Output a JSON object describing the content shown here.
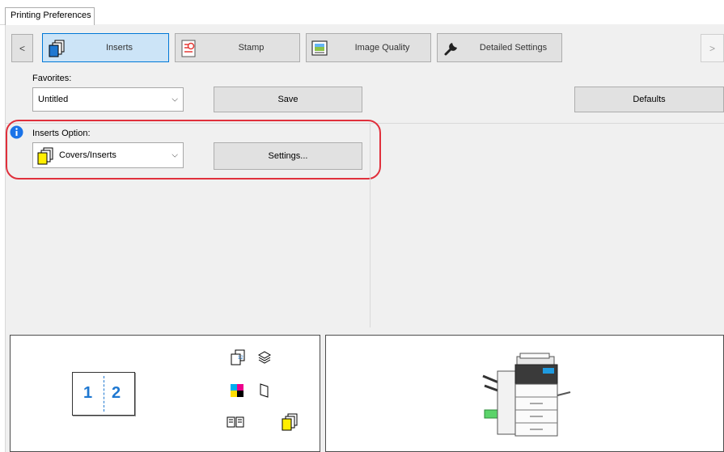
{
  "window": {
    "tab_label": "Printing Preferences"
  },
  "nav": {
    "prev_arrow": "<",
    "next_arrow": ">",
    "tabs": [
      {
        "label": "Inserts",
        "icon": "inserts-icon",
        "selected": true
      },
      {
        "label": "Stamp",
        "icon": "stamp-icon",
        "selected": false
      },
      {
        "label": "Image Quality",
        "icon": "image-quality-icon",
        "selected": false
      },
      {
        "label": "Detailed Settings",
        "icon": "wrench-icon",
        "selected": false
      }
    ]
  },
  "favorites": {
    "label": "Favorites:",
    "value": "Untitled",
    "save_label": "Save",
    "defaults_label": "Defaults"
  },
  "inserts_option": {
    "label": "Inserts Option:",
    "value": "Covers/Inserts",
    "settings_label": "Settings..."
  },
  "preview": {
    "page_left": "1",
    "page_right": "2"
  },
  "colors": {
    "highlight": "#e0303c",
    "selected_tab": "#cce4f7",
    "info_blue": "#1a73e8"
  }
}
